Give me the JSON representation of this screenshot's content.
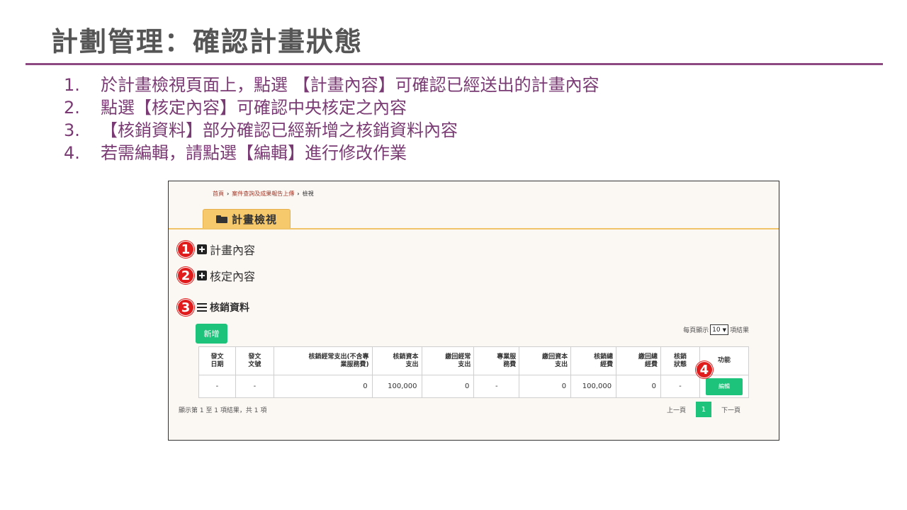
{
  "slide": {
    "title": "計劃管理：確認計畫狀態",
    "steps": [
      {
        "num": "1.",
        "text": "於計畫檢視頁面上，點選 【計畫內容】可確認已經送出的計畫內容"
      },
      {
        "num": "2.",
        "text": "點選【核定內容】可確認中央核定之內容"
      },
      {
        "num": "3.",
        "text": "【核銷資料】部分確認已經新增之核銷資料內容"
      },
      {
        "num": "4.",
        "text": "若需編輯，請點選【編輯】進行修改作業"
      }
    ]
  },
  "screenshot": {
    "breadcrumb": {
      "home": "首頁",
      "sep": "›",
      "middle": "案件查詢及成果報告上傳",
      "current": "檢視"
    },
    "page_tab": {
      "label": "計畫檢視",
      "icon": "folder-open-icon"
    },
    "sections": [
      {
        "badge": "1",
        "label": "計畫內容",
        "icon": "plus-square-icon"
      },
      {
        "badge": "2",
        "label": "核定內容",
        "icon": "plus-square-icon"
      },
      {
        "badge": "3",
        "label": "核銷資料",
        "icon": "list-icon"
      }
    ],
    "add_button": "新增",
    "page_size": {
      "prefix": "每頁顯示",
      "value": "10",
      "suffix": "項結果"
    },
    "table": {
      "headers": [
        "發文\n日期",
        "發文\n文號",
        "核銷經常支出(不含專\n業服務費)",
        "核銷資本\n支出",
        "繳回經常\n支出",
        "專業服\n務費",
        "繳回資本\n支出",
        "核銷總\n經費",
        "繳回總\n經費",
        "核銷\n狀態",
        "功能"
      ],
      "rows": [
        [
          "-",
          "-",
          "0",
          "100,000",
          "0",
          "-",
          "0",
          "100,000",
          "0",
          "-"
        ]
      ],
      "edit_label": "編輯",
      "edit_badge": "4"
    },
    "summary": "顯示第 1 至 1 項結果，共 1 項",
    "pager": {
      "prev": "上一頁",
      "current": "1",
      "next": "下一頁"
    },
    "colors": {
      "accent_green": "#1ec37b",
      "tab_yellow": "#f6c96c",
      "badge_red": "#e01c1c",
      "title_rule": "#8d4a82"
    }
  }
}
